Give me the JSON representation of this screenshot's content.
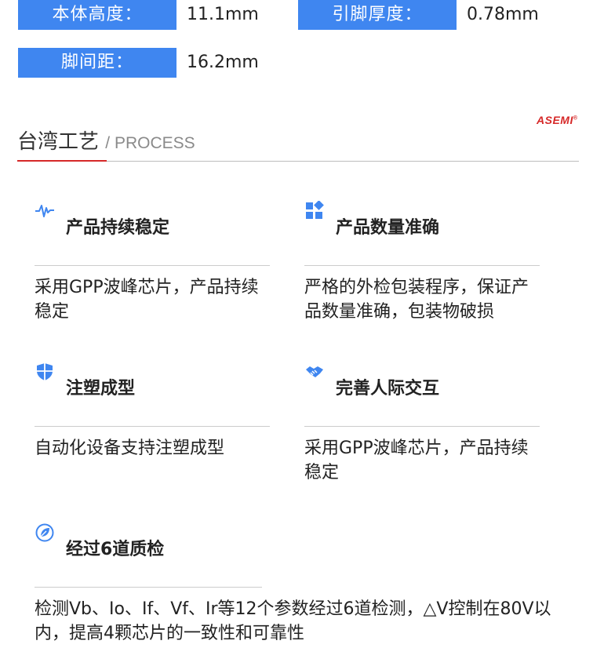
{
  "specs": {
    "body_height": {
      "label": "本体高度：",
      "value": "11.1mm"
    },
    "lead_thickness": {
      "label": "引脚厚度：",
      "value": "0.78mm"
    },
    "pin_pitch": {
      "label": "脚间距：",
      "value": "16.2mm"
    }
  },
  "section": {
    "title": "台湾工艺",
    "subtitle": "/ PROCESS",
    "brand": "ASEMI",
    "brand_mark": "®"
  },
  "colors": {
    "accent_blue": "#3f86f0",
    "brand_red": "#d62828",
    "rule_gray": "#bdbdbd"
  },
  "features": [
    {
      "icon": "pulse-icon",
      "title": "产品持续稳定",
      "desc": "采用GPP波峰芯片，产品持续稳定"
    },
    {
      "icon": "grid-blocks-icon",
      "title": "产品数量准确",
      "desc": "严格的外检包装程序，保证产品数量准确，包装物破损"
    },
    {
      "icon": "shield-icon",
      "title": "注塑成型",
      "desc": "自动化设备支持注塑成型"
    },
    {
      "icon": "handshake-icon",
      "title": "完善人际交互",
      "desc": "采用GPP波峰芯片，产品持续稳定"
    },
    {
      "icon": "leaf-icon",
      "title": "经过6道质检",
      "desc": "检测Vb、Io、If、Vf、Ir等12个参数经过6道检测，△V控制在80V以内，提高4颗芯片的一致性和可靠性"
    }
  ]
}
